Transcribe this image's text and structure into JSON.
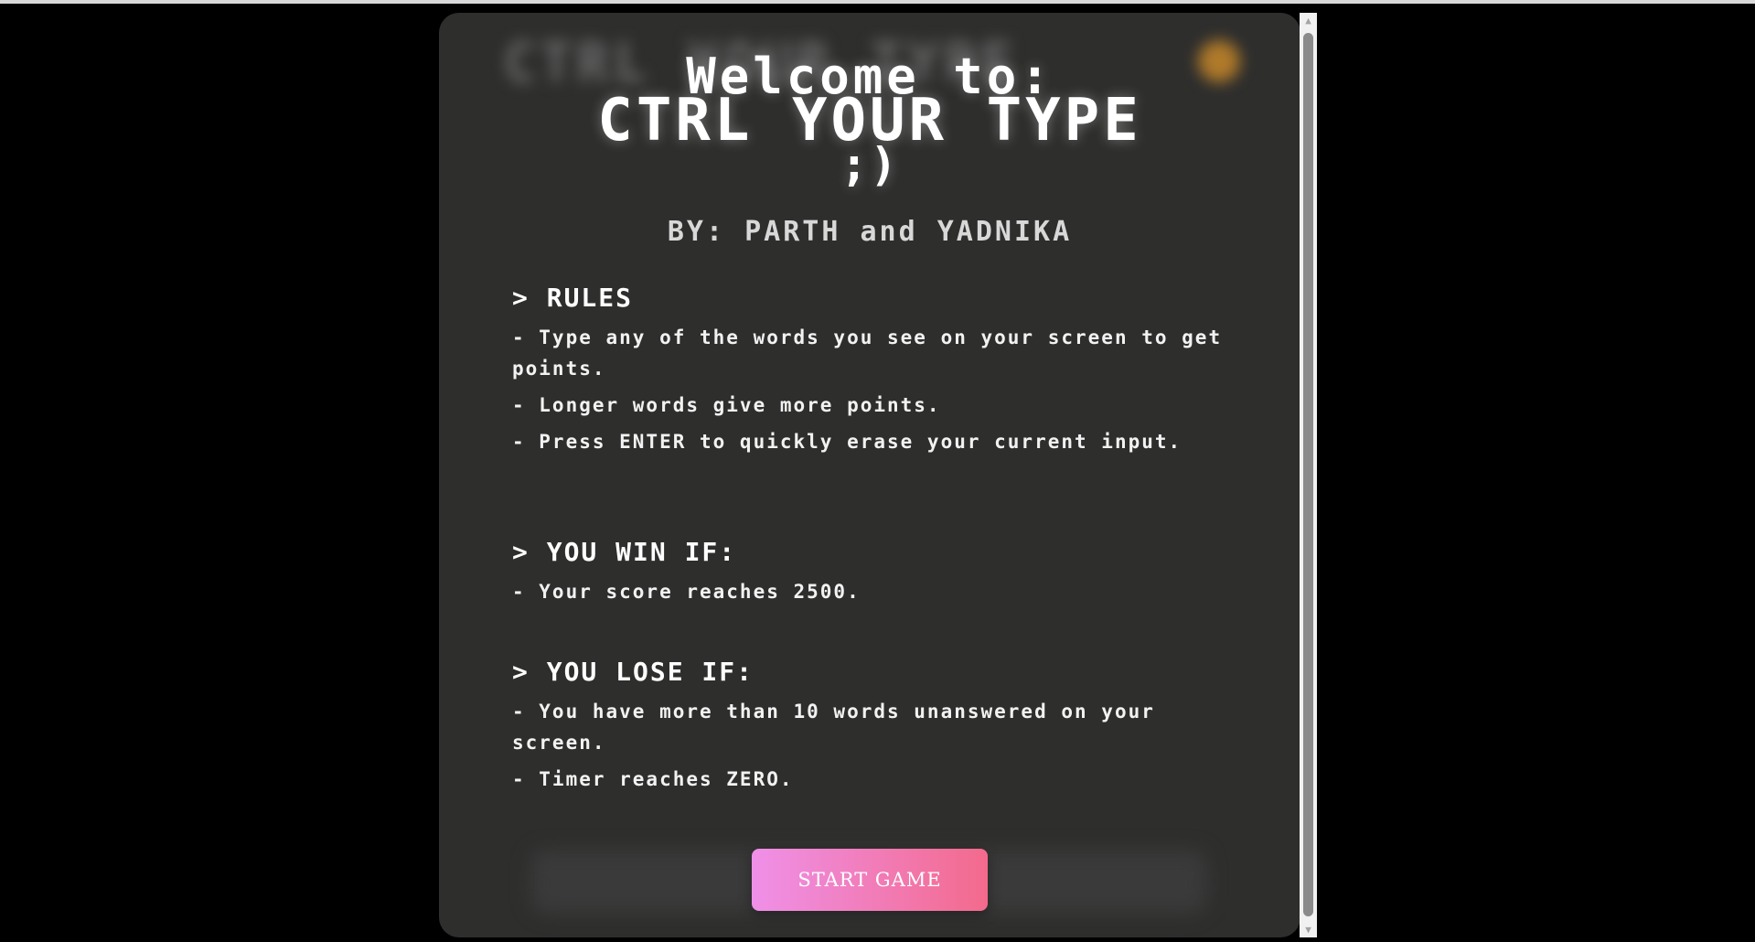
{
  "welcome": {
    "line1": "Welcome to:",
    "line2": "CTRL YOUR TYPE",
    "line3": ";)"
  },
  "byline": "BY: PARTH and YADNIKA",
  "rules": {
    "heading": "> RULES",
    "items": [
      "- Type any of the words you see on your screen to get points.",
      "- Longer words give more points.",
      "- Press ENTER to quickly erase your current input."
    ]
  },
  "win": {
    "heading": "> YOU WIN IF:",
    "items": [
      "- Your score reaches 2500."
    ]
  },
  "lose": {
    "heading": "> YOU LOSE IF:",
    "items": [
      "- You have more than 10 words unanswered on your screen.",
      "- Timer reaches ZERO."
    ]
  },
  "start_button": "START GAME",
  "colors": {
    "modal_bg": "#2e2e2d",
    "button_gradient_start": "#ef90e8",
    "button_gradient_end": "#f36a8c"
  },
  "icons": {
    "scroll_up": "scroll-up-arrow-icon",
    "scroll_down": "scroll-down-arrow-icon"
  }
}
